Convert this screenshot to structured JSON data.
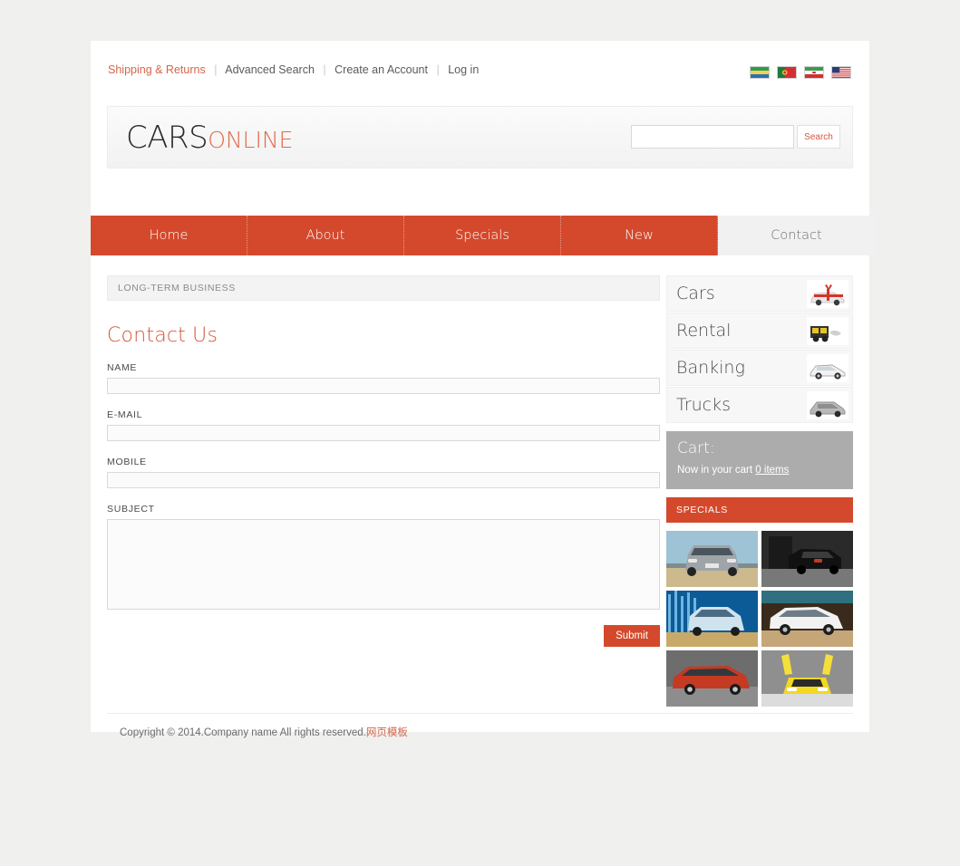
{
  "topbar": {
    "links": [
      {
        "label": "Shipping & Returns",
        "accent": true
      },
      {
        "label": "Advanced Search",
        "accent": false
      },
      {
        "label": "Create an Account",
        "accent": false
      },
      {
        "label": "Log in",
        "accent": false
      }
    ],
    "separator": "|",
    "flags": [
      {
        "name": "flag-gabon",
        "colors": [
          "#2a9d4f",
          "#f5d04a",
          "#2f6fb5"
        ]
      },
      {
        "name": "flag-portugal",
        "colors": [
          "#d42f2f",
          "#1f7a3a",
          "#f5d04a"
        ]
      },
      {
        "name": "flag-iran",
        "colors": [
          "#3a9a52",
          "#ffffff",
          "#d42f2f"
        ]
      },
      {
        "name": "flag-usa",
        "colors": [
          "#d42f2f",
          "#ffffff",
          "#2a3b7a"
        ]
      }
    ]
  },
  "brand": {
    "part1": "CARS",
    "part2": "ONLINE"
  },
  "search": {
    "value": "",
    "placeholder": "",
    "button_label": "Search"
  },
  "nav": {
    "items": [
      {
        "label": "Home",
        "active": false
      },
      {
        "label": "About",
        "active": false
      },
      {
        "label": "Specials",
        "active": false
      },
      {
        "label": "New",
        "active": false
      },
      {
        "label": "Contact",
        "active": true
      }
    ]
  },
  "main": {
    "breadcrumb": "LONG-TERM BUSINESS",
    "heading": "Contact Us",
    "fields": [
      {
        "label": "NAME",
        "value": "",
        "placeholder": "",
        "type": "text"
      },
      {
        "label": "E-MAIL",
        "value": "",
        "placeholder": "",
        "type": "text"
      },
      {
        "label": "MOBILE",
        "value": "",
        "placeholder": "",
        "type": "text"
      },
      {
        "label": "SUBJECT",
        "value": "",
        "placeholder": "",
        "type": "textarea"
      }
    ],
    "submit_label": "Submit"
  },
  "aside": {
    "categories": [
      {
        "label": "Cars",
        "icon": "car-with-ribbon-icon"
      },
      {
        "label": "Rental",
        "icon": "yellow-truck-icon"
      },
      {
        "label": "Banking",
        "icon": "white-coupe-icon"
      },
      {
        "label": "Trucks",
        "icon": "grey-car-icon"
      }
    ],
    "cart": {
      "title": "Cart:",
      "text": "Now in your cart",
      "items_link": "0 items"
    },
    "specials_title": "SPECIALS",
    "specials": [
      {
        "name": "silver-sedan-front-thumb"
      },
      {
        "name": "black-sedan-rear-thumb"
      },
      {
        "name": "blue-sedan-splash-thumb"
      },
      {
        "name": "white-coupe-thumb"
      },
      {
        "name": "red-hatchback-thumb"
      },
      {
        "name": "yellow-supercar-thumb"
      }
    ]
  },
  "footer": {
    "text": "Copyright © 2014.Company name All rights reserved.",
    "link": "网页模板"
  },
  "colors": {
    "accent": "#d4492c",
    "accent_text": "#d4573a",
    "page_bg": "#f0f0ef",
    "cart_bg": "#acacac"
  }
}
